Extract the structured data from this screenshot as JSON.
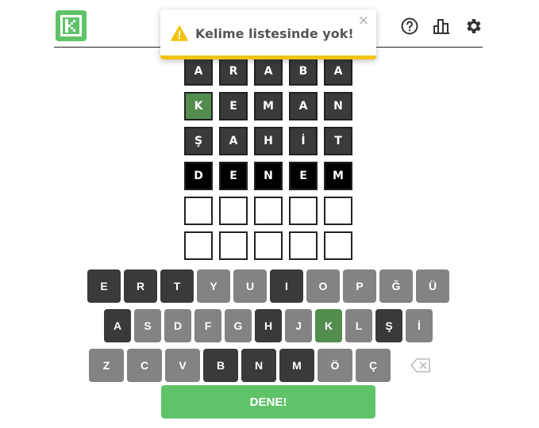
{
  "toast": {
    "message": "Kelime listesinde yok!",
    "close": "×"
  },
  "colors": {
    "absent": "#3a3a3c",
    "correct": "#538d4e",
    "unused": "#818384",
    "accent": "#5fc36a",
    "warning": "#f2c20f"
  },
  "header": {
    "icons": [
      "help-icon",
      "stats-icon",
      "settings-icon"
    ]
  },
  "board": {
    "rows": [
      {
        "letters": [
          "A",
          "R",
          "A",
          "B",
          "A"
        ],
        "states": [
          "absent",
          "absent",
          "absent",
          "absent",
          "absent"
        ]
      },
      {
        "letters": [
          "K",
          "E",
          "M",
          "A",
          "N"
        ],
        "states": [
          "correct",
          "absent",
          "absent",
          "absent",
          "absent"
        ]
      },
      {
        "letters": [
          "Ş",
          "A",
          "H",
          "İ",
          "T"
        ],
        "states": [
          "absent",
          "absent",
          "absent",
          "absent",
          "absent"
        ]
      },
      {
        "letters": [
          "D",
          "E",
          "N",
          "E",
          "M"
        ],
        "states": [
          "tbd",
          "tbd",
          "tbd",
          "tbd",
          "tbd"
        ]
      },
      {
        "letters": [
          "",
          "",
          "",
          "",
          ""
        ],
        "states": [
          "empty",
          "empty",
          "empty",
          "empty",
          "empty"
        ]
      },
      {
        "letters": [
          "",
          "",
          "",
          "",
          ""
        ],
        "states": [
          "empty",
          "empty",
          "empty",
          "empty",
          "empty"
        ]
      }
    ]
  },
  "keyboard": {
    "rows": [
      [
        {
          "label": "E",
          "state": "absent"
        },
        {
          "label": "R",
          "state": "absent"
        },
        {
          "label": "T",
          "state": "absent"
        },
        {
          "label": "Y",
          "state": "unused"
        },
        {
          "label": "U",
          "state": "unused"
        },
        {
          "label": "I",
          "state": "absent"
        },
        {
          "label": "O",
          "state": "unused"
        },
        {
          "label": "P",
          "state": "unused"
        },
        {
          "label": "Ğ",
          "state": "unused"
        },
        {
          "label": "Ü",
          "state": "unused"
        }
      ],
      [
        {
          "label": "A",
          "state": "absent"
        },
        {
          "label": "S",
          "state": "unused"
        },
        {
          "label": "D",
          "state": "unused"
        },
        {
          "label": "F",
          "state": "unused"
        },
        {
          "label": "G",
          "state": "unused"
        },
        {
          "label": "H",
          "state": "absent"
        },
        {
          "label": "J",
          "state": "unused"
        },
        {
          "label": "K",
          "state": "correct"
        },
        {
          "label": "L",
          "state": "unused"
        },
        {
          "label": "Ş",
          "state": "absent"
        },
        {
          "label": "İ",
          "state": "unused"
        }
      ],
      [
        {
          "label": "Z",
          "state": "unused"
        },
        {
          "label": "C",
          "state": "unused"
        },
        {
          "label": "V",
          "state": "unused"
        },
        {
          "label": "B",
          "state": "absent"
        },
        {
          "label": "N",
          "state": "absent"
        },
        {
          "label": "M",
          "state": "absent"
        },
        {
          "label": "Ö",
          "state": "unused"
        },
        {
          "label": "Ç",
          "state": "unused"
        },
        {
          "label": "",
          "state": "del",
          "icon": "backspace-icon"
        }
      ]
    ],
    "enter_label": "DENE!"
  }
}
